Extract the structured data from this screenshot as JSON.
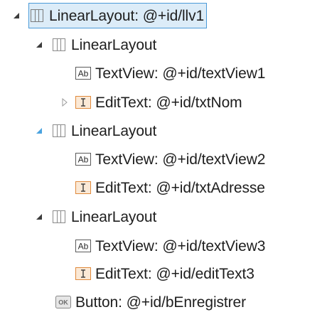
{
  "tree": {
    "root": {
      "label": "LinearLayout: @+id/llv1",
      "icon": "linear-layout-icon",
      "expanded": true,
      "selected": true
    },
    "groups": [
      {
        "label": "LinearLayout",
        "icon": "linear-layout-icon",
        "expanded": true,
        "expander_color": "#3c3c3c",
        "children": [
          {
            "label": "TextView: @+id/textView1",
            "icon": "textview-icon"
          },
          {
            "label": "EditText: @+id/txtNom",
            "icon": "edittext-icon",
            "collapsed_expander": true
          }
        ]
      },
      {
        "label": "LinearLayout",
        "icon": "linear-layout-icon",
        "expanded": true,
        "expander_color": "#4aa3df",
        "children": [
          {
            "label": "TextView: @+id/textView2",
            "icon": "textview-icon"
          },
          {
            "label": "EditText: @+id/txtAdresse",
            "icon": "edittext-icon"
          }
        ]
      },
      {
        "label": "LinearLayout",
        "icon": "linear-layout-icon",
        "expanded": true,
        "expander_color": "#3c3c3c",
        "children": [
          {
            "label": "TextView: @+id/textView3",
            "icon": "textview-icon"
          },
          {
            "label": "EditText: @+id/editText3",
            "icon": "edittext-icon"
          }
        ]
      }
    ],
    "button": {
      "label": "Button: @+id/bEnregistrer",
      "icon": "button-icon",
      "icon_text": "OK"
    },
    "textview_icon_text": "Ab"
  },
  "colors": {
    "selection_border": "#4a9ad8",
    "selection_fill": "#dcecf8",
    "expander": "#3c3c3c",
    "expander_hot": "#4aa3df",
    "edittext_accent": "#e08a3c"
  }
}
